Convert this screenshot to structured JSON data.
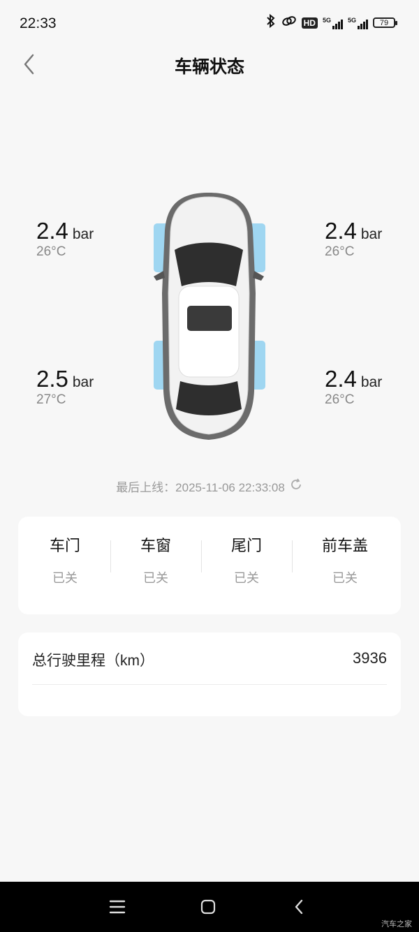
{
  "status_bar": {
    "time": "22:33",
    "hd_label": "HD",
    "sim1_label": "5G",
    "sim2_label": "5G",
    "battery": "79"
  },
  "header": {
    "title": "车辆状态"
  },
  "tires": {
    "front_left": {
      "pressure": "2.4",
      "unit": "bar",
      "temp": "26°C"
    },
    "front_right": {
      "pressure": "2.4",
      "unit": "bar",
      "temp": "26°C"
    },
    "rear_left": {
      "pressure": "2.5",
      "unit": "bar",
      "temp": "27°C"
    },
    "rear_right": {
      "pressure": "2.4",
      "unit": "bar",
      "temp": "26°C"
    }
  },
  "last_online": "最后上线：2025-11-06 22:33:08",
  "status_items": [
    {
      "label": "车门",
      "value": "已关"
    },
    {
      "label": "车窗",
      "value": "已关"
    },
    {
      "label": "尾门",
      "value": "已关"
    },
    {
      "label": "前车盖",
      "value": "已关"
    }
  ],
  "mileage": {
    "label": "总行驶里程（km）",
    "value": "3936"
  },
  "watermark": "汽车之家",
  "colors": {
    "tire_highlight": "#8fd0f0",
    "background": "#f7f7f7",
    "card": "#ffffff"
  }
}
